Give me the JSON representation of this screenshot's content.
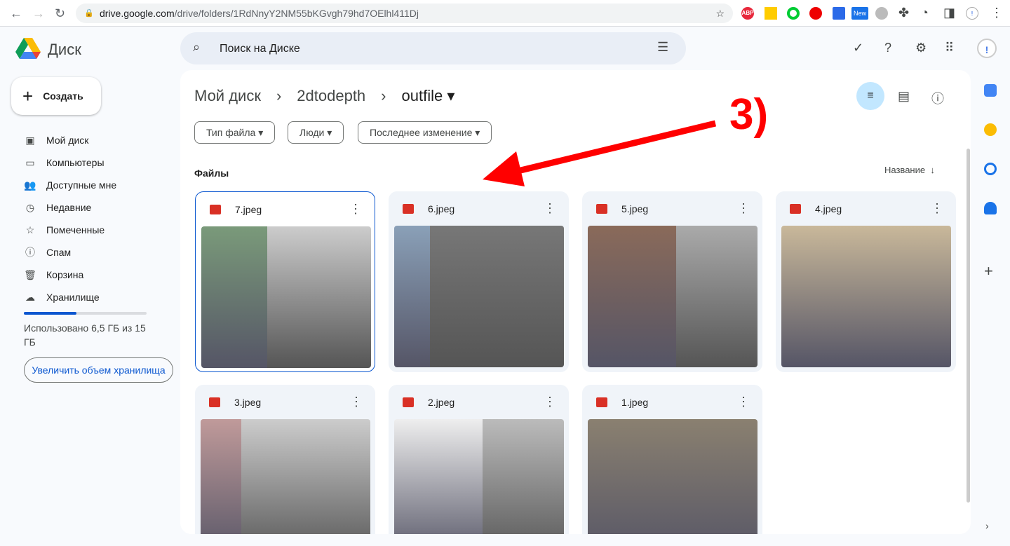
{
  "browser": {
    "url_host": "drive.google.com",
    "url_path": "/drive/folders/1RdNnyY2NM55bKGvgh79hd7OElhl411Dj",
    "ext_abp": "ABP",
    "ext_new": "New"
  },
  "app": {
    "name": "Диск",
    "search_placeholder": "Поиск на Диске"
  },
  "sidebar": {
    "create": "Создать",
    "items": [
      {
        "label": "Мой диск",
        "icon": "drive-icon"
      },
      {
        "label": "Компьютеры",
        "icon": "computer-icon"
      },
      {
        "label": "Доступные мне",
        "icon": "people-icon"
      },
      {
        "label": "Недавние",
        "icon": "clock-icon"
      },
      {
        "label": "Помеченные",
        "icon": "star-icon"
      },
      {
        "label": "Спам",
        "icon": "spam-icon"
      },
      {
        "label": "Корзина",
        "icon": "trash-icon"
      },
      {
        "label": "Хранилище",
        "icon": "cloud-icon"
      }
    ],
    "storage_used": "Использовано 6,5 ГБ из 15 ГБ",
    "storage_fraction": 0.43,
    "upgrade": "Увеличить объем хранилища"
  },
  "breadcrumb": [
    "Мой диск",
    "2dtodepth",
    "outfile"
  ],
  "filters": [
    "Тип файла",
    "Люди",
    "Последнее изменение"
  ],
  "section": "Файлы",
  "sort": "Название",
  "files": [
    "7.jpeg",
    "6.jpeg",
    "5.jpeg",
    "4.jpeg",
    "3.jpeg",
    "2.jpeg",
    "1.jpeg"
  ],
  "annotation": {
    "label": "3)",
    "color": "#ff0000"
  }
}
